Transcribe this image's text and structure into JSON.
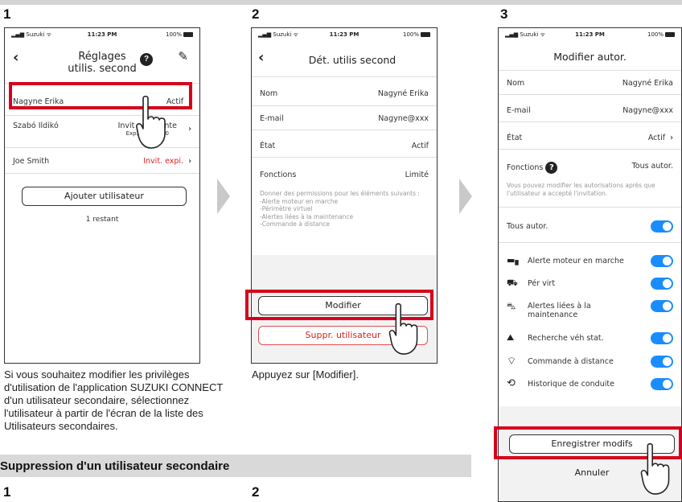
{
  "steps": {
    "s1": "1",
    "s2": "2",
    "s3": "3",
    "s4": "1",
    "s5": "2"
  },
  "status": {
    "carrier": "Suzuki",
    "time": "11:23 PM",
    "battery": "100%"
  },
  "screen1": {
    "title_line1": "Réglages",
    "title_line2": "utilis. second",
    "users": [
      {
        "name": "Nagyne Erika",
        "status": "Actif",
        "status_color": "#333333"
      },
      {
        "name": "Szabó Ildikó",
        "status": "Invit en attente",
        "sub": "Exp23/11/2020",
        "status_color": "#333333"
      },
      {
        "name": "Joe Smith",
        "status": "Invit. expi.",
        "status_color": "#e02020"
      }
    ],
    "add_button": "Ajouter utilisateur",
    "remaining": "1 restant"
  },
  "screen2": {
    "title": "Dét. utilis second",
    "rows": [
      {
        "label": "Nom",
        "value": "Nagyné Erika"
      },
      {
        "label": "E-mail",
        "value": "Nagyne@xxx"
      },
      {
        "label": "État",
        "value": "Actif"
      },
      {
        "label": "Fonctions",
        "value": "Limité"
      }
    ],
    "permissions_text": "Donner des permissions pour les éléments suivants :",
    "permissions": [
      "-Alerte moteur en marche",
      "-Périmètre virtuel",
      "-Alertes liées à la maintenance",
      "-Commande à distance"
    ],
    "modify_button": "Modifier",
    "delete_button": "Suppr. utilisateur"
  },
  "screen3": {
    "title": "Modifier autor.",
    "rows": [
      {
        "label": "Nom",
        "value": "Nagyné Erika"
      },
      {
        "label": "E-mail",
        "value": "Nagyne@xxx"
      },
      {
        "label": "État",
        "value": "Actif"
      }
    ],
    "functions_label": "Fonctions",
    "functions_value": "Tous autor.",
    "note": "Vous pouvez modifier les autorisations après que l'utilisateur a accepté l'invitation.",
    "all_label": "Tous autor.",
    "features": [
      {
        "label": "Alerte moteur en marche",
        "icon": "car-icon"
      },
      {
        "label": "Pér virt",
        "icon": "geofence-icon"
      },
      {
        "label": "Alertes liées à la maintenance",
        "icon": "maintenance-icon"
      },
      {
        "label": "Recherche véh stat.",
        "icon": "map-pin-icon"
      },
      {
        "label": "Commande à distance",
        "icon": "remote-icon"
      },
      {
        "label": "Historique de conduite",
        "icon": "history-icon"
      }
    ],
    "save_button": "Enregistrer modifs",
    "cancel_button": "Annuler"
  },
  "captions": {
    "c1": "Si vous souhaitez modifier les privilèges d'utilisation de l'application SUZUKI CONNECT d'un utilisateur secondaire, sélectionnez l'utilisateur à partir de l'écran de la liste des Utilisateurs secondaires.",
    "c2": "Appuyez sur [Modifier]."
  },
  "section": {
    "title": "Suppression d'un utilisateur secondaire"
  },
  "colors": {
    "highlight": "#d6001c",
    "toggle_on": "#1a8cff",
    "expired": "#e02020"
  }
}
